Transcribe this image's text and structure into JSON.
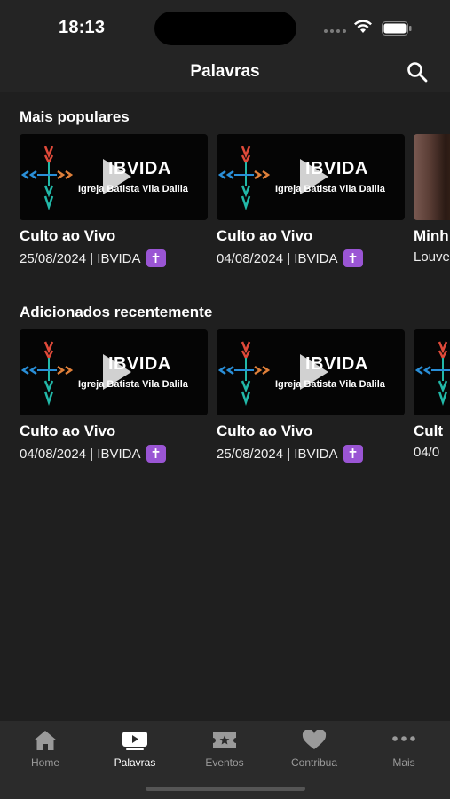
{
  "status": {
    "time": "18:13"
  },
  "header": {
    "title": "Palavras",
    "search_icon": "search-icon"
  },
  "sections": [
    {
      "title": "Mais populares",
      "cards": [
        {
          "brand": "IBVIDA",
          "subtitle": "Igreja Batista Vila Dalila",
          "title": "Culto ao Vivo",
          "meta": "25/08/2024 | IBVIDA",
          "badge": "✝"
        },
        {
          "brand": "IBVIDA",
          "subtitle": "Igreja Batista Vila Dalila",
          "title": "Culto ao Vivo",
          "meta": "04/08/2024 | IBVIDA",
          "badge": "✝"
        },
        {
          "title": "Minh",
          "meta": "Louve"
        }
      ]
    },
    {
      "title": "Adicionados recentemente",
      "cards": [
        {
          "brand": "IBVIDA",
          "subtitle": "Igreja Batista Vila Dalila",
          "title": "Culto ao Vivo",
          "meta": "04/08/2024 | IBVIDA",
          "badge": "✝"
        },
        {
          "brand": "IBVIDA",
          "subtitle": "Igreja Batista Vila Dalila",
          "title": "Culto ao Vivo",
          "meta": "25/08/2024 | IBVIDA",
          "badge": "✝"
        },
        {
          "title": "Cult",
          "meta": "04/0"
        }
      ]
    }
  ],
  "tabs": [
    {
      "label": "Home",
      "icon": "home-icon"
    },
    {
      "label": "Palavras",
      "icon": "video-icon",
      "active": true
    },
    {
      "label": "Eventos",
      "icon": "ticket-icon"
    },
    {
      "label": "Contribua",
      "icon": "heart-icon"
    },
    {
      "label": "Mais",
      "icon": "more-icon"
    }
  ],
  "colors": {
    "background": "#1f1f1f",
    "bar": "#242424",
    "tab_bar": "#2b2b2b",
    "badge": "#9a55d4",
    "inactive": "#9a9a9a"
  }
}
